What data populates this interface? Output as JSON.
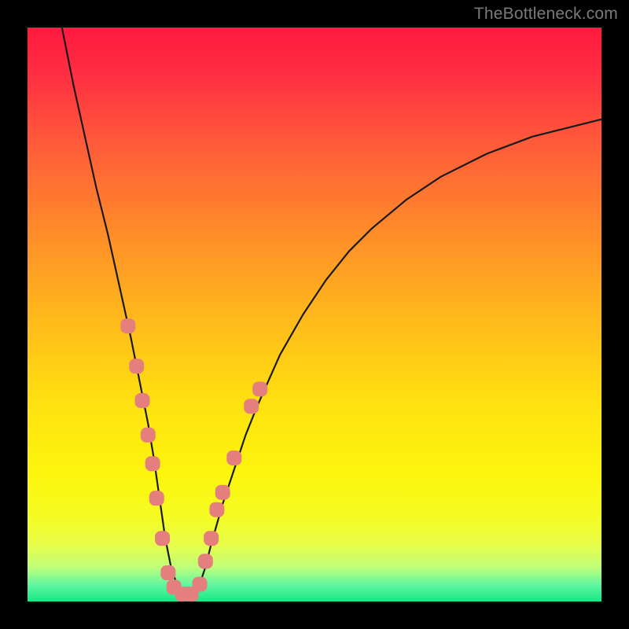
{
  "watermark": {
    "text": "TheBottleneck.com"
  },
  "colors": {
    "curve_stroke": "#1a1a1a",
    "marker_fill": "#e57f7d",
    "marker_stroke": "#e57f7d"
  },
  "chart_data": {
    "type": "line",
    "title": "",
    "xlabel": "",
    "ylabel": "",
    "xlim": [
      0,
      100
    ],
    "ylim": [
      0,
      100
    ],
    "grid": false,
    "legend": false,
    "series": [
      {
        "name": "curve",
        "x": [
          6,
          8,
          10,
          12,
          14,
          16,
          18,
          19,
          20,
          21,
          22,
          23,
          24,
          25,
          26,
          27,
          28,
          29,
          30,
          31,
          32,
          34,
          36,
          38,
          40,
          44,
          48,
          52,
          56,
          60,
          66,
          72,
          80,
          88,
          96,
          100
        ],
        "y": [
          100,
          90,
          81,
          72,
          64,
          55,
          46,
          41,
          36,
          31,
          25,
          18,
          11,
          6,
          3,
          1.5,
          1,
          1.5,
          3,
          6,
          10,
          17,
          23,
          29,
          34,
          43,
          50,
          56,
          61,
          65,
          70,
          74,
          78,
          81,
          83,
          84
        ]
      }
    ],
    "markers": [
      {
        "x": 17.5,
        "y": 48
      },
      {
        "x": 19.0,
        "y": 41
      },
      {
        "x": 20.0,
        "y": 35
      },
      {
        "x": 21.0,
        "y": 29
      },
      {
        "x": 21.8,
        "y": 24
      },
      {
        "x": 22.5,
        "y": 18
      },
      {
        "x": 23.5,
        "y": 11
      },
      {
        "x": 24.5,
        "y": 5
      },
      {
        "x": 25.5,
        "y": 2.5
      },
      {
        "x": 27.0,
        "y": 1.3
      },
      {
        "x": 28.5,
        "y": 1.3
      },
      {
        "x": 30.0,
        "y": 3
      },
      {
        "x": 31.0,
        "y": 7
      },
      {
        "x": 32.0,
        "y": 11
      },
      {
        "x": 33.0,
        "y": 16
      },
      {
        "x": 34.0,
        "y": 19
      },
      {
        "x": 36.0,
        "y": 25
      },
      {
        "x": 39.0,
        "y": 34
      },
      {
        "x": 40.5,
        "y": 37
      }
    ],
    "marker_radius_px": 9
  }
}
